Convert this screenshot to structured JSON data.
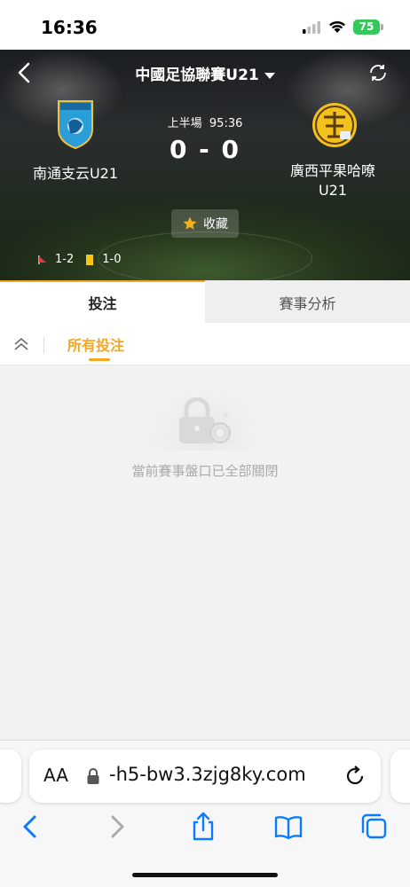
{
  "status_bar": {
    "time": "16:36",
    "battery": "75"
  },
  "header": {
    "title": "中國足協聯賽U21",
    "period_label": "上半場",
    "match_time": "95:36",
    "score": "0 - 0",
    "home_team": "南通支云U21",
    "away_team_line1": "廣西平果哈嘹",
    "away_team_line2": "U21",
    "favorite_label": "收藏",
    "corners": "1-2",
    "yellow_cards": "1-0"
  },
  "tabs": [
    {
      "label": "投注",
      "active": true
    },
    {
      "label": "賽事分析",
      "active": false
    }
  ],
  "subbar": {
    "filter_label": "所有投注"
  },
  "empty_state": {
    "message": "當前賽事盤口已全部關閉"
  },
  "browser": {
    "aa_label": "AA",
    "url": "-h5-bw3.3zjg8ky.com"
  },
  "colors": {
    "accent": "#f5a623",
    "battery": "#34c759",
    "ios_blue": "#0a7aff"
  }
}
